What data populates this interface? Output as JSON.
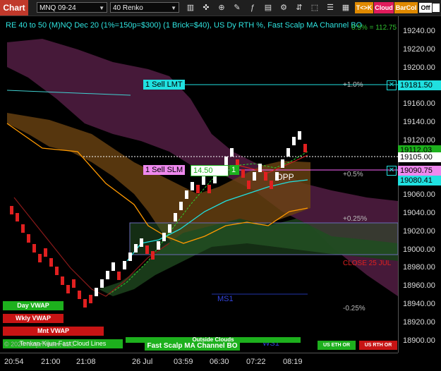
{
  "toolbar": {
    "chart_tab": "Chart",
    "instrument": "MNQ 09-24",
    "bar_type": "40 Renko",
    "btn_tk": "T<>K",
    "btn_cloud": "Cloud",
    "btn_barcol": "BarCol",
    "btn_off": "Off"
  },
  "chart_title": "RE 40 to 50 (M)NQ Dec 20 (1%=150p=$300) (1 Brick=$40), US Dy RTH %, Fast Scalp MA Channel BO",
  "top_right_value": "0.5% = 112.75",
  "price_axis": [
    "19240.00",
    "19220.00",
    "19200.00",
    "19180.00",
    "19160.00",
    "19140.00",
    "19120.00",
    "19100.00",
    "19080.00",
    "19060.00",
    "19040.00",
    "19020.00",
    "19000.00",
    "18980.00",
    "18960.00",
    "18940.00",
    "18920.00",
    "18900.00"
  ],
  "price_labels": {
    "sell_lmt_price": "19181.50",
    "green_price": "19112.03",
    "current_price": "19105.00",
    "sell_slm_price": "19090.75",
    "cyan_price": "19080.41"
  },
  "orders": {
    "sell_lmt": "1 Sell LMT",
    "sell_slm": "1 Sell SLM",
    "slm_offset": "14.50",
    "slm_qty": "1"
  },
  "levels": {
    "plus_1": "+1.0%",
    "plus_05": "+0.5%",
    "plus_025": "+0.25%",
    "close": "CLOSE 25 JUL",
    "minus_025": "-0.25%",
    "dpp": "DPP",
    "ms1": "MS1",
    "ws1": "WS1",
    "outside_clouds": "Outside Clouds"
  },
  "legend": {
    "day_vwap": "Day VWAP",
    "wkly_vwap": "Wkly VWAP",
    "mnt_vwap": "Mnt VWAP",
    "copyright": "© 2024 NinjaTrader, LLC",
    "tenkan": "Tenkan-Kijun-Fast Cloud Lines",
    "fast_scalp": "Fast Scalp MA Channel BO",
    "us_eth": "US ETH OR",
    "us_rth": "US RTH OR"
  },
  "time_axis": [
    "20:54",
    "21:00",
    "21:08",
    "26 Jul",
    "03:59",
    "06:30",
    "07:22",
    "08:19"
  ],
  "colors": {
    "up_brick": "#ffffff",
    "down_brick": "#e02020",
    "cyan_line": "#20e0e0",
    "orange_line": "#ff9900",
    "accent_green": "#1db01d"
  }
}
